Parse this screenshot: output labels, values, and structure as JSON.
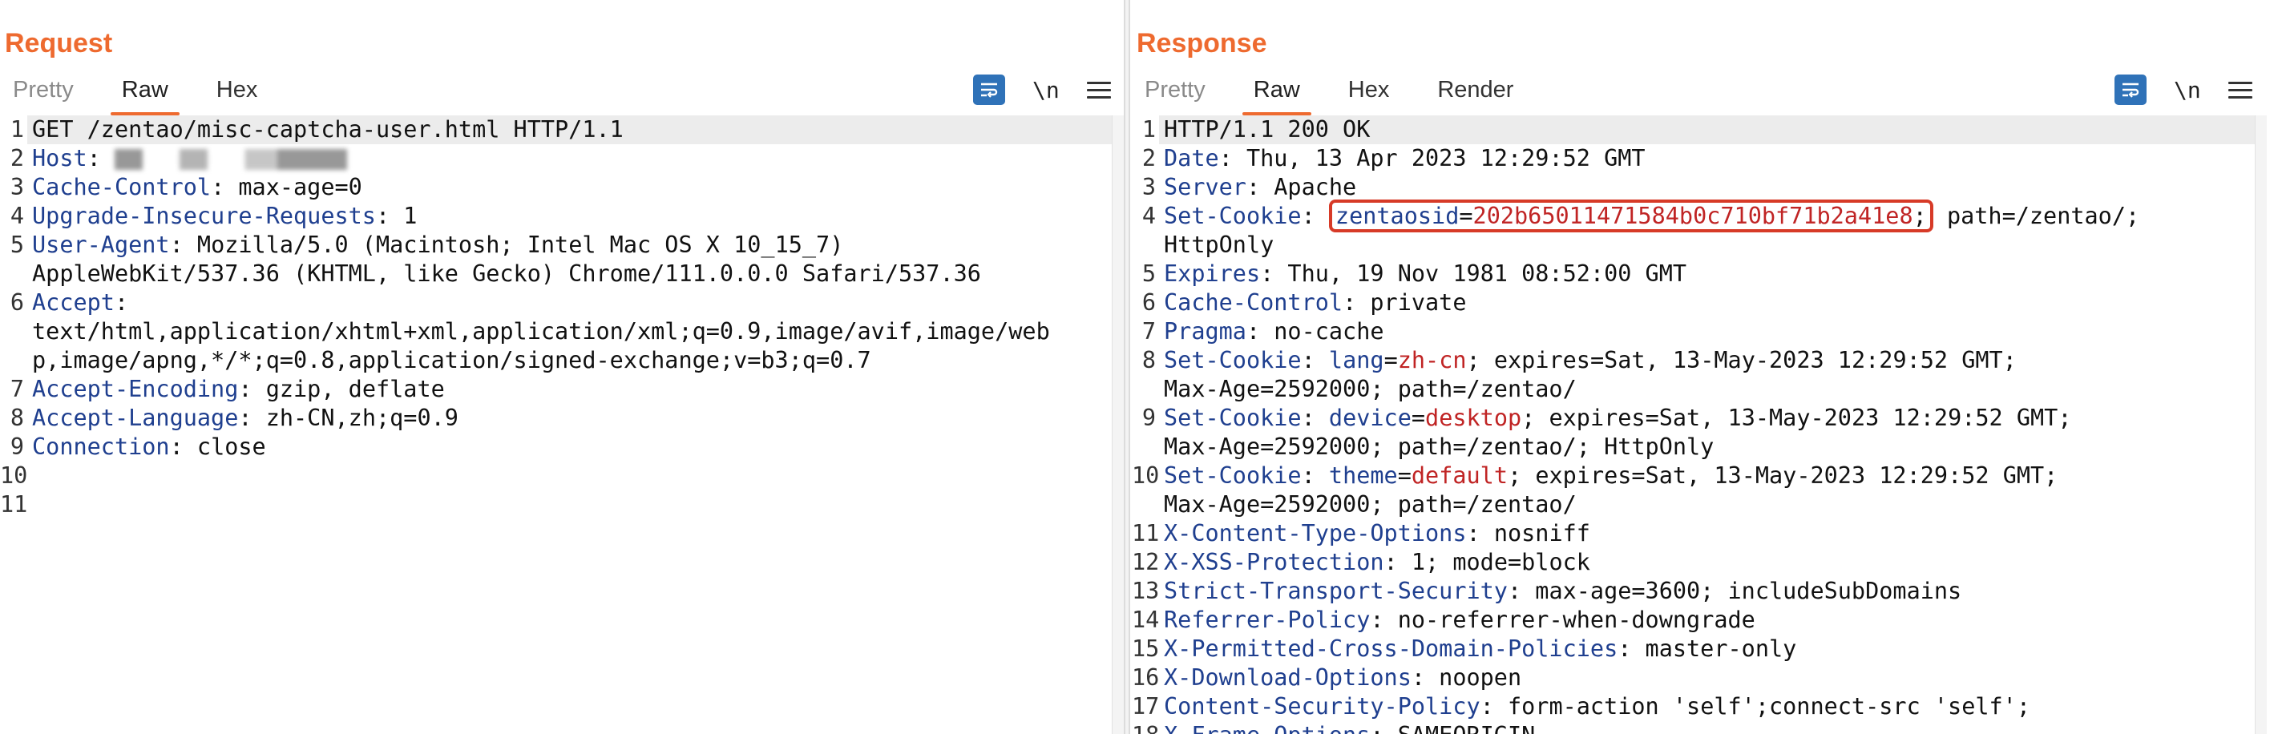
{
  "request": {
    "title": "Request",
    "tabs": [
      "Pretty",
      "Raw",
      "Hex"
    ],
    "active_tab": "Raw",
    "newline_label": "\\n",
    "lines": [
      {
        "n": "1",
        "parts": [
          {
            "t": "GET /zentao/misc-captcha-user.html HTTP/1.1",
            "c": ""
          }
        ]
      },
      {
        "n": "2",
        "parts": [
          {
            "t": "Host",
            "c": "hn"
          },
          {
            "t": ": ",
            "c": ""
          },
          {
            "t": "9999",
            "c": "blur"
          }
        ]
      },
      {
        "n": "3",
        "parts": [
          {
            "t": "Cache-Control",
            "c": "hn"
          },
          {
            "t": ": max-age=0",
            "c": ""
          }
        ]
      },
      {
        "n": "4",
        "parts": [
          {
            "t": "Upgrade-Insecure-Requests",
            "c": "hn"
          },
          {
            "t": ": 1",
            "c": ""
          }
        ]
      },
      {
        "n": "5",
        "parts": [
          {
            "t": "User-Agent",
            "c": "hn"
          },
          {
            "t": ": Mozilla/5.0 (Macintosh; Intel Mac OS X 10_15_7)",
            "c": ""
          }
        ]
      },
      {
        "n": "",
        "parts": [
          {
            "t": "AppleWebKit/537.36 (KHTML, like Gecko) Chrome/111.0.0.0 Safari/537.36",
            "c": ""
          }
        ]
      },
      {
        "n": "6",
        "parts": [
          {
            "t": "Accept",
            "c": "hn"
          },
          {
            "t": ":",
            "c": ""
          }
        ]
      },
      {
        "n": "",
        "parts": [
          {
            "t": "text/html,application/xhtml+xml,application/xml;q=0.9,image/avif,image/web",
            "c": ""
          }
        ]
      },
      {
        "n": "",
        "parts": [
          {
            "t": "p,image/apng,*/*;q=0.8,application/signed-exchange;v=b3;q=0.7",
            "c": ""
          }
        ]
      },
      {
        "n": "7",
        "parts": [
          {
            "t": "Accept-Encoding",
            "c": "hn"
          },
          {
            "t": ": gzip, deflate",
            "c": ""
          }
        ]
      },
      {
        "n": "8",
        "parts": [
          {
            "t": "Accept-Language",
            "c": "hn"
          },
          {
            "t": ": zh-CN,zh;q=0.9",
            "c": ""
          }
        ]
      },
      {
        "n": "9",
        "parts": [
          {
            "t": "Connection",
            "c": "hn"
          },
          {
            "t": ": close",
            "c": ""
          }
        ]
      },
      {
        "n": "10",
        "parts": []
      },
      {
        "n": "11",
        "parts": []
      }
    ]
  },
  "response": {
    "title": "Response",
    "tabs": [
      "Pretty",
      "Raw",
      "Hex",
      "Render"
    ],
    "active_tab": "Raw",
    "newline_label": "\\n",
    "lines": [
      {
        "n": "1",
        "parts": [
          {
            "t": "HTTP/1.1 200 OK",
            "c": ""
          }
        ]
      },
      {
        "n": "2",
        "parts": [
          {
            "t": "Date",
            "c": "hn"
          },
          {
            "t": ": Thu, 13 Apr 2023 12:29:52 GMT",
            "c": ""
          }
        ]
      },
      {
        "n": "3",
        "parts": [
          {
            "t": "Server",
            "c": "hn"
          },
          {
            "t": ": Apache",
            "c": ""
          }
        ]
      },
      {
        "n": "4",
        "parts": [
          {
            "t": "Set-Cookie",
            "c": "hn"
          },
          {
            "t": ": ",
            "c": ""
          },
          {
            "t": "zentaosid",
            "c": "box-hn"
          },
          {
            "t": "=",
            "c": "box"
          },
          {
            "t": "202b65011471584b0c710bf71b2a41e8",
            "c": "box-cv"
          },
          {
            "t": ";",
            "c": "box-end"
          },
          {
            "t": " path=/zentao/;",
            "c": ""
          }
        ]
      },
      {
        "n": "",
        "parts": [
          {
            "t": "HttpOnly",
            "c": ""
          }
        ]
      },
      {
        "n": "5",
        "parts": [
          {
            "t": "Expires",
            "c": "hn"
          },
          {
            "t": ": Thu, 19 Nov 1981 08:52:00 GMT",
            "c": ""
          }
        ]
      },
      {
        "n": "6",
        "parts": [
          {
            "t": "Cache-Control",
            "c": "hn"
          },
          {
            "t": ": private",
            "c": ""
          }
        ]
      },
      {
        "n": "7",
        "parts": [
          {
            "t": "Pragma",
            "c": "hn"
          },
          {
            "t": ": no-cache",
            "c": ""
          }
        ]
      },
      {
        "n": "8",
        "parts": [
          {
            "t": "Set-Cookie",
            "c": "hn"
          },
          {
            "t": ": ",
            "c": ""
          },
          {
            "t": "lang",
            "c": "hn"
          },
          {
            "t": "=",
            "c": ""
          },
          {
            "t": "zh-cn",
            "c": "cv"
          },
          {
            "t": "; expires=Sat, 13-May-2023 12:29:52 GMT;",
            "c": ""
          }
        ]
      },
      {
        "n": "",
        "parts": [
          {
            "t": "Max-Age=2592000; path=/zentao/",
            "c": ""
          }
        ]
      },
      {
        "n": "9",
        "parts": [
          {
            "t": "Set-Cookie",
            "c": "hn"
          },
          {
            "t": ": ",
            "c": ""
          },
          {
            "t": "device",
            "c": "hn"
          },
          {
            "t": "=",
            "c": ""
          },
          {
            "t": "desktop",
            "c": "cv"
          },
          {
            "t": "; expires=Sat, 13-May-2023 12:29:52 GMT;",
            "c": ""
          }
        ]
      },
      {
        "n": "",
        "parts": [
          {
            "t": "Max-Age=2592000; path=/zentao/; HttpOnly",
            "c": ""
          }
        ]
      },
      {
        "n": "10",
        "parts": [
          {
            "t": "Set-Cookie",
            "c": "hn"
          },
          {
            "t": ": ",
            "c": ""
          },
          {
            "t": "theme",
            "c": "hn"
          },
          {
            "t": "=",
            "c": ""
          },
          {
            "t": "default",
            "c": "cv"
          },
          {
            "t": "; expires=Sat, 13-May-2023 12:29:52 GMT;",
            "c": ""
          }
        ]
      },
      {
        "n": "",
        "parts": [
          {
            "t": "Max-Age=2592000; path=/zentao/",
            "c": ""
          }
        ]
      },
      {
        "n": "11",
        "parts": [
          {
            "t": "X-Content-Type-Options",
            "c": "hn"
          },
          {
            "t": ": nosniff",
            "c": ""
          }
        ]
      },
      {
        "n": "12",
        "parts": [
          {
            "t": "X-XSS-Protection",
            "c": "hn"
          },
          {
            "t": ": 1; mode=block",
            "c": ""
          }
        ]
      },
      {
        "n": "13",
        "parts": [
          {
            "t": "Strict-Transport-Security",
            "c": "hn"
          },
          {
            "t": ": max-age=3600; includeSubDomains",
            "c": ""
          }
        ]
      },
      {
        "n": "14",
        "parts": [
          {
            "t": "Referrer-Policy",
            "c": "hn"
          },
          {
            "t": ": no-referrer-when-downgrade",
            "c": ""
          }
        ]
      },
      {
        "n": "15",
        "parts": [
          {
            "t": "X-Permitted-Cross-Domain-Policies",
            "c": "hn"
          },
          {
            "t": ": master-only",
            "c": ""
          }
        ]
      },
      {
        "n": "16",
        "parts": [
          {
            "t": "X-Download-Options",
            "c": "hn"
          },
          {
            "t": ": noopen",
            "c": ""
          }
        ]
      },
      {
        "n": "17",
        "parts": [
          {
            "t": "Content-Security-Policy",
            "c": "hn"
          },
          {
            "t": ": form-action 'self';connect-src 'self';",
            "c": ""
          }
        ]
      },
      {
        "n": "18",
        "parts": [
          {
            "t": "X-Frame-Options",
            "c": "hn"
          },
          {
            "t": ": SAMEORIGIN",
            "c": ""
          }
        ]
      }
    ]
  },
  "colors": {
    "accent": "#ee6a2f",
    "header_name": "#1f3f8f",
    "cookie_value": "#c02424",
    "highlight_box": "#d73a27",
    "button_blue": "#2f72b8"
  },
  "icons": {
    "wrap": "wrap-lines-icon",
    "menu": "hamburger-menu-icon",
    "layout": [
      "layout-side-by-side-icon",
      "layout-stacked-icon",
      "layout-single-icon"
    ]
  }
}
